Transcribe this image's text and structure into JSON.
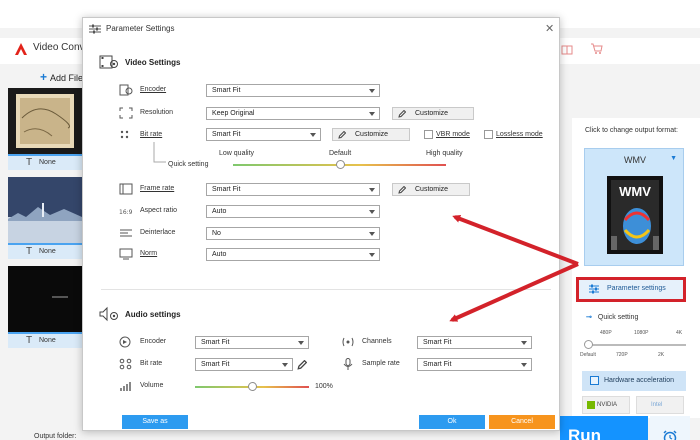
{
  "app": {
    "title": "Video Conv",
    "add_files_label": "Add File",
    "thumbs": [
      {
        "label": "None"
      },
      {
        "label": "None"
      },
      {
        "label": "None"
      }
    ],
    "output_folder_label": "Output folder:",
    "run_label": "Run"
  },
  "right_panel": {
    "caption": "Click to change output format:",
    "format_name": "WMV",
    "format_icon_text": "WMV",
    "parameter_settings_label": "Parameter settings",
    "quick_setting_label": "Quick setting",
    "quick_ticks_top": [
      "480P",
      "1080P",
      "4K"
    ],
    "quick_ticks_bottom": [
      "Default",
      "720P",
      "2K"
    ],
    "hardware_accel_label": "Hardware acceleration",
    "gpu_badges": [
      "NVIDIA",
      "Intel"
    ]
  },
  "dialog": {
    "title": "Parameter Settings",
    "video_section_title": "Video Settings",
    "audio_section_title": "Audio settings",
    "video": {
      "encoder_label": "Encoder",
      "encoder_value": "Smart Fit",
      "resolution_label": "Resolution",
      "resolution_value": "Keep Original",
      "bitrate_label": "Bit rate",
      "bitrate_value": "Smart Fit",
      "customize_label": "Customize",
      "vbr_label": "VBR mode",
      "lossless_label": "Lossless mode",
      "quick_setting_label": "Quick setting",
      "low_quality_label": "Low quality",
      "default_label": "Default",
      "high_quality_label": "High quality",
      "quick_setting_level": 0.5,
      "framerate_label": "Frame rate",
      "framerate_value": "Smart Fit",
      "aspect_label": "Aspect ratio",
      "aspect_value": "Auto",
      "deinterlace_label": "Deinterlace",
      "deinterlace_value": "No",
      "norm_label": "Norm",
      "norm_value": "Auto"
    },
    "audio": {
      "encoder_label": "Encoder",
      "encoder_value": "Smart Fit",
      "bitrate_label": "Bit rate",
      "bitrate_value": "Smart Fit",
      "channels_label": "Channels",
      "channels_value": "Smart Fit",
      "samplerate_label": "Sample rate",
      "samplerate_value": "Smart Fit",
      "volume_label": "Volume",
      "volume_value": "100%",
      "volume_level": 0.5
    },
    "footer": {
      "save_as_label": "Save as",
      "ok_label": "Ok",
      "cancel_label": "Cancel"
    }
  },
  "colors": {
    "accent": "#1493ff",
    "footer_blue": "#2d9bf0",
    "cancel_orange": "#f7941d",
    "annotation_red": "#d3222a"
  }
}
